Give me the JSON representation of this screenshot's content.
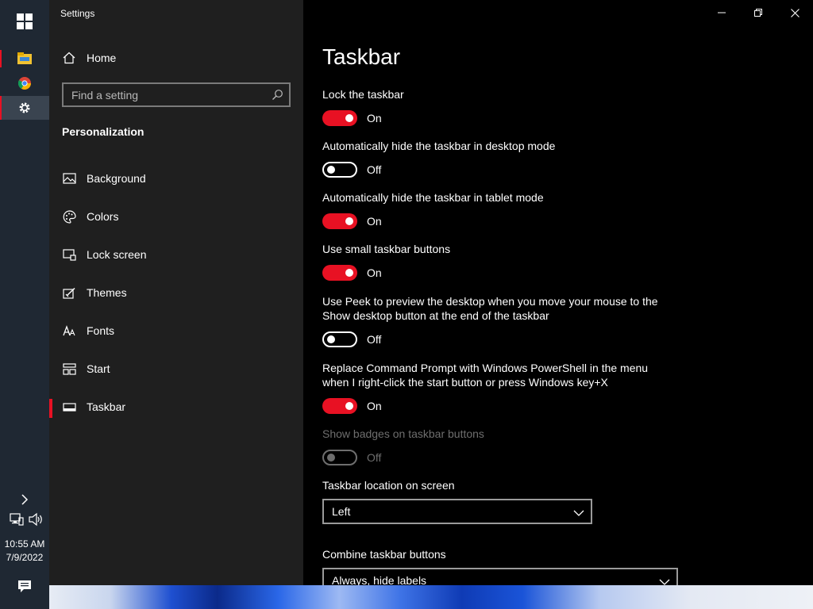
{
  "window": {
    "app_title": "Settings"
  },
  "sidebar": {
    "home_label": "Home",
    "search_placeholder": "Find a setting",
    "section_title": "Personalization",
    "items": [
      {
        "label": "Background",
        "icon": "image-icon"
      },
      {
        "label": "Colors",
        "icon": "palette-icon"
      },
      {
        "label": "Lock screen",
        "icon": "lock-screen-icon"
      },
      {
        "label": "Themes",
        "icon": "themes-icon"
      },
      {
        "label": "Fonts",
        "icon": "fonts-icon"
      },
      {
        "label": "Start",
        "icon": "start-icon"
      },
      {
        "label": "Taskbar",
        "icon": "taskbar-icon",
        "active": true
      }
    ]
  },
  "content": {
    "title": "Taskbar",
    "settings": [
      {
        "label": "Lock the taskbar",
        "state": "On"
      },
      {
        "label": "Automatically hide the taskbar in desktop mode",
        "state": "Off"
      },
      {
        "label": "Automatically hide the taskbar in tablet mode",
        "state": "On"
      },
      {
        "label": "Use small taskbar buttons",
        "state": "On"
      },
      {
        "label": "Use Peek to preview the desktop when you move your mouse to the Show desktop button at the end of the taskbar",
        "state": "Off"
      },
      {
        "label": "Replace Command Prompt with Windows PowerShell in the menu when I right-click the start button or press Windows key+X",
        "state": "On"
      },
      {
        "label": "Show badges on taskbar buttons",
        "state": "Off",
        "disabled": true
      }
    ],
    "location_label": "Taskbar location on screen",
    "location_value": "Left",
    "combine_label": "Combine taskbar buttons",
    "combine_value": "Always, hide labels"
  },
  "taskbar": {
    "time": "10:55 AM",
    "date": "7/9/2022"
  },
  "colors": {
    "accent": "#e81123",
    "sidebar_bg": "#1f1f1f",
    "content_bg": "#000000",
    "taskbar_bg": "#1f2833"
  }
}
